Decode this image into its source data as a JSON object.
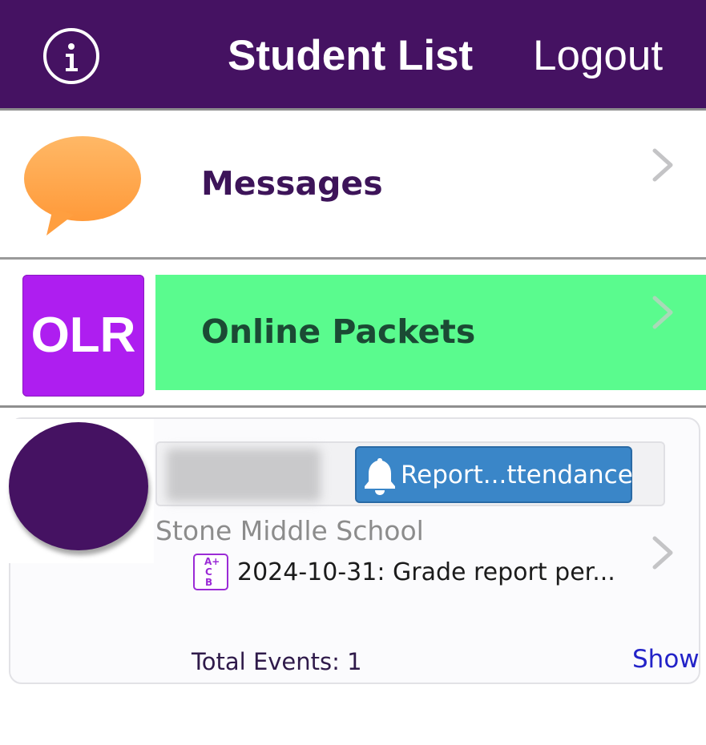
{
  "header": {
    "title": "Student List",
    "logout_label": "Logout",
    "info_icon": "info-circle-icon",
    "background": "#451262"
  },
  "menu": {
    "messages": {
      "label": "Messages",
      "icon": "speech-bubble-icon",
      "icon_color": "#ffa64a"
    },
    "online_packets": {
      "badge_text": "OLR",
      "label": "Online Packets",
      "row_color": "#5afb8e",
      "badge_color": "#ae1ef0"
    }
  },
  "student_card": {
    "report_button_label": "Report...ttendance",
    "report_icon": "bell-icon",
    "school": "Stone Middle School",
    "event": {
      "icon": "grade-report-icon",
      "icon_letters": [
        "A+",
        "C",
        "B"
      ],
      "text": "2024-10-31: Grade report per..."
    },
    "total_events": "Total Events: 1",
    "show_label": "Show"
  }
}
